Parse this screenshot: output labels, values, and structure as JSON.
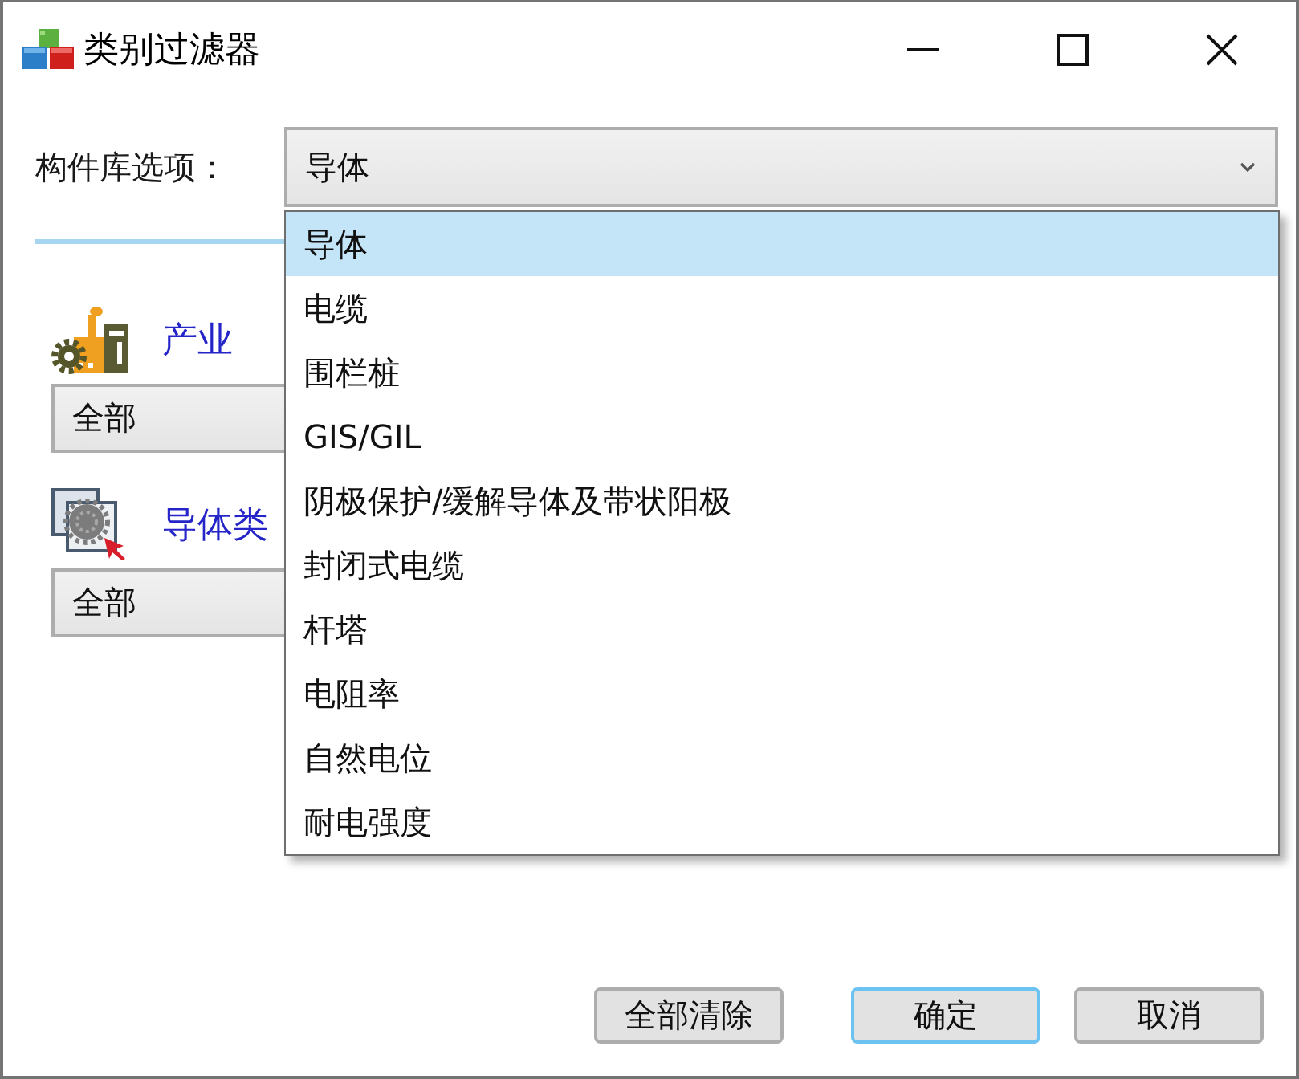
{
  "window": {
    "title": "类别过滤器"
  },
  "library": {
    "label": "构件库选项：",
    "value": "导体",
    "options": [
      {
        "label": "导体",
        "selected": true
      },
      {
        "label": "电缆",
        "selected": false
      },
      {
        "label": "围栏桩",
        "selected": false
      },
      {
        "label": "GIS/GIL",
        "selected": false
      },
      {
        "label": "阴极保护/缓解导体及带状阳极",
        "selected": false
      },
      {
        "label": "封闭式电缆",
        "selected": false
      },
      {
        "label": "杆塔",
        "selected": false
      },
      {
        "label": "电阻率",
        "selected": false
      },
      {
        "label": "自然电位",
        "selected": false
      },
      {
        "label": "耐电强度",
        "selected": false
      }
    ]
  },
  "filters": [
    {
      "kind": "industry",
      "label": "产业",
      "value": "全部"
    },
    {
      "kind": "category",
      "label": "导体类",
      "value": "全部"
    }
  ],
  "buttons": [
    {
      "label": "全部清除",
      "default": false
    },
    {
      "label": "确定",
      "default": true
    },
    {
      "label": "取消",
      "default": false
    }
  ]
}
